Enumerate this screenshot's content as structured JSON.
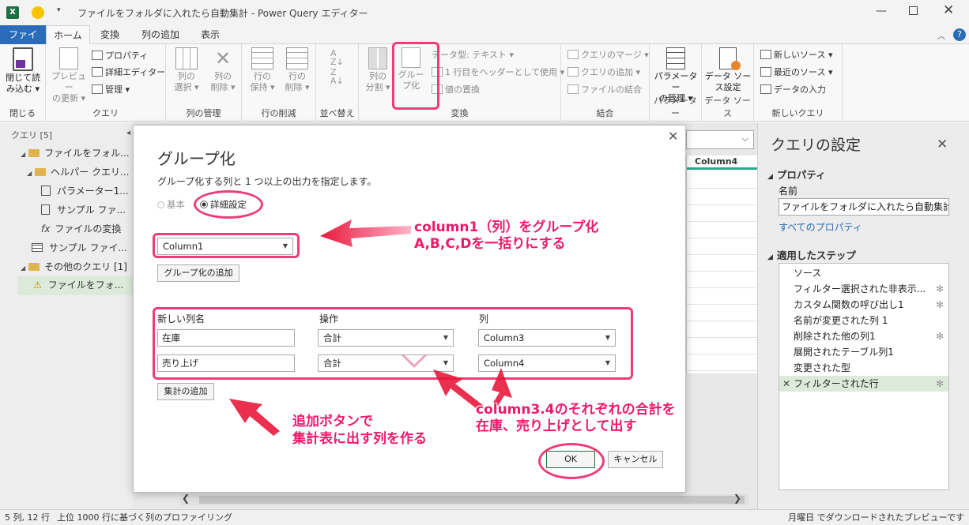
{
  "window": {
    "title": "ファイルをフォルダに入れたら自動集計 - Power Query エディター"
  },
  "ribbon_tabs": [
    "ファイル",
    "ホーム",
    "変換",
    "列の追加",
    "表示"
  ],
  "ribbon": {
    "close": {
      "btn": "閉じて読\nみ込む ▾",
      "label": "閉じる"
    },
    "query": {
      "preview": "プレビュー\nの更新 ▾",
      "properties": "プロパティ",
      "advanced_editor": "詳細エディター",
      "manage": "管理 ▾",
      "label": "クエリ"
    },
    "columns": {
      "choose": "列の\n選択 ▾",
      "remove": "列の\n削除 ▾",
      "label": "列の管理"
    },
    "rows": {
      "keep": "行の\n保持 ▾",
      "remove": "行の\n削除 ▾",
      "label": "行の削減"
    },
    "sort": {
      "label": "並べ替え"
    },
    "transform": {
      "split": "列の\n分割 ▾",
      "group": "グルー\nプ化",
      "datatype": "データ型: テキスト ▾",
      "header": "1 行目をヘッダーとして使用 ▾",
      "replace": "値の置換",
      "label": "変換"
    },
    "combine": {
      "merge": "クエリのマージ ▾",
      "append": "クエリの追加 ▾",
      "files": "ファイルの結合",
      "label": "結合"
    },
    "params": {
      "manage": "パラメーター\nの管理 ▾",
      "label": "パラメーター"
    },
    "datasource": {
      "settings": "データ ソー\nス設定",
      "label": "データ ソース"
    },
    "newquery": {
      "new": "新しいソース ▾",
      "recent": "最近のソース ▾",
      "enter": "データの入力",
      "label": "新しいクエリ"
    }
  },
  "left_pane": {
    "header": "クエリ [5]",
    "items": [
      "ファイルをフォル...",
      "ヘルパー クエリ...",
      "パラメーター1...",
      "サンプル ファ...",
      "ファイルの変換",
      "サンプル ファイ...",
      "その他のクエリ [1]",
      "ファイルをフォ..."
    ]
  },
  "grid": {
    "column_header": "Column4"
  },
  "right_pane": {
    "title": "クエリの設定",
    "properties_header": "プロパティ",
    "name_label": "名前",
    "name_value": "ファイルをフォルダに入れたら自動集計",
    "all_properties": "すべてのプロパティ",
    "steps_header": "適用したステップ",
    "steps": [
      "ソース",
      "フィルター選択された非表示...",
      "カスタム関数の呼び出し1",
      "名前が変更された列 1",
      "削除された他の列1",
      "展開されたテーブル列1",
      "変更された型",
      "フィルターされた行"
    ]
  },
  "status": {
    "left": "5 列, 12 行",
    "profiling": "上位 1000 行に基づく列のプロファイリング",
    "right": "月曜日 でダウンロードされたプレビューです"
  },
  "dialog": {
    "title": "グループ化",
    "subtitle": "グループ化する列と 1 つ以上の出力を指定します。",
    "radio_basic": "基本",
    "radio_advanced": "詳細設定",
    "group_column": "Column1",
    "add_grouping": "グループ化の追加",
    "headers": {
      "new_col": "新しい列名",
      "operation": "操作",
      "column": "列"
    },
    "rows": [
      {
        "name": "在庫",
        "op": "合計",
        "col": "Column3"
      },
      {
        "name": "売り上げ",
        "op": "合計",
        "col": "Column4"
      }
    ],
    "add_aggregation": "集計の追加",
    "ok": "OK",
    "cancel": "キャンセル"
  },
  "annotations": {
    "a1_line1": "column1（列）をグループ化",
    "a1_line2": "A,B,C,Dを一括りにする",
    "a2_line1": "追加ボタンで",
    "a2_line2": "集計表に出す列を作る",
    "a3_line1": "column3.4のそれぞれの合計を",
    "a3_line2": "在庫、売り上げとして出す"
  },
  "colors": {
    "accent": "#217346",
    "tab_blue": "#2b6cb8",
    "highlight": "#ee3d74",
    "annotation": "#f0196c"
  }
}
